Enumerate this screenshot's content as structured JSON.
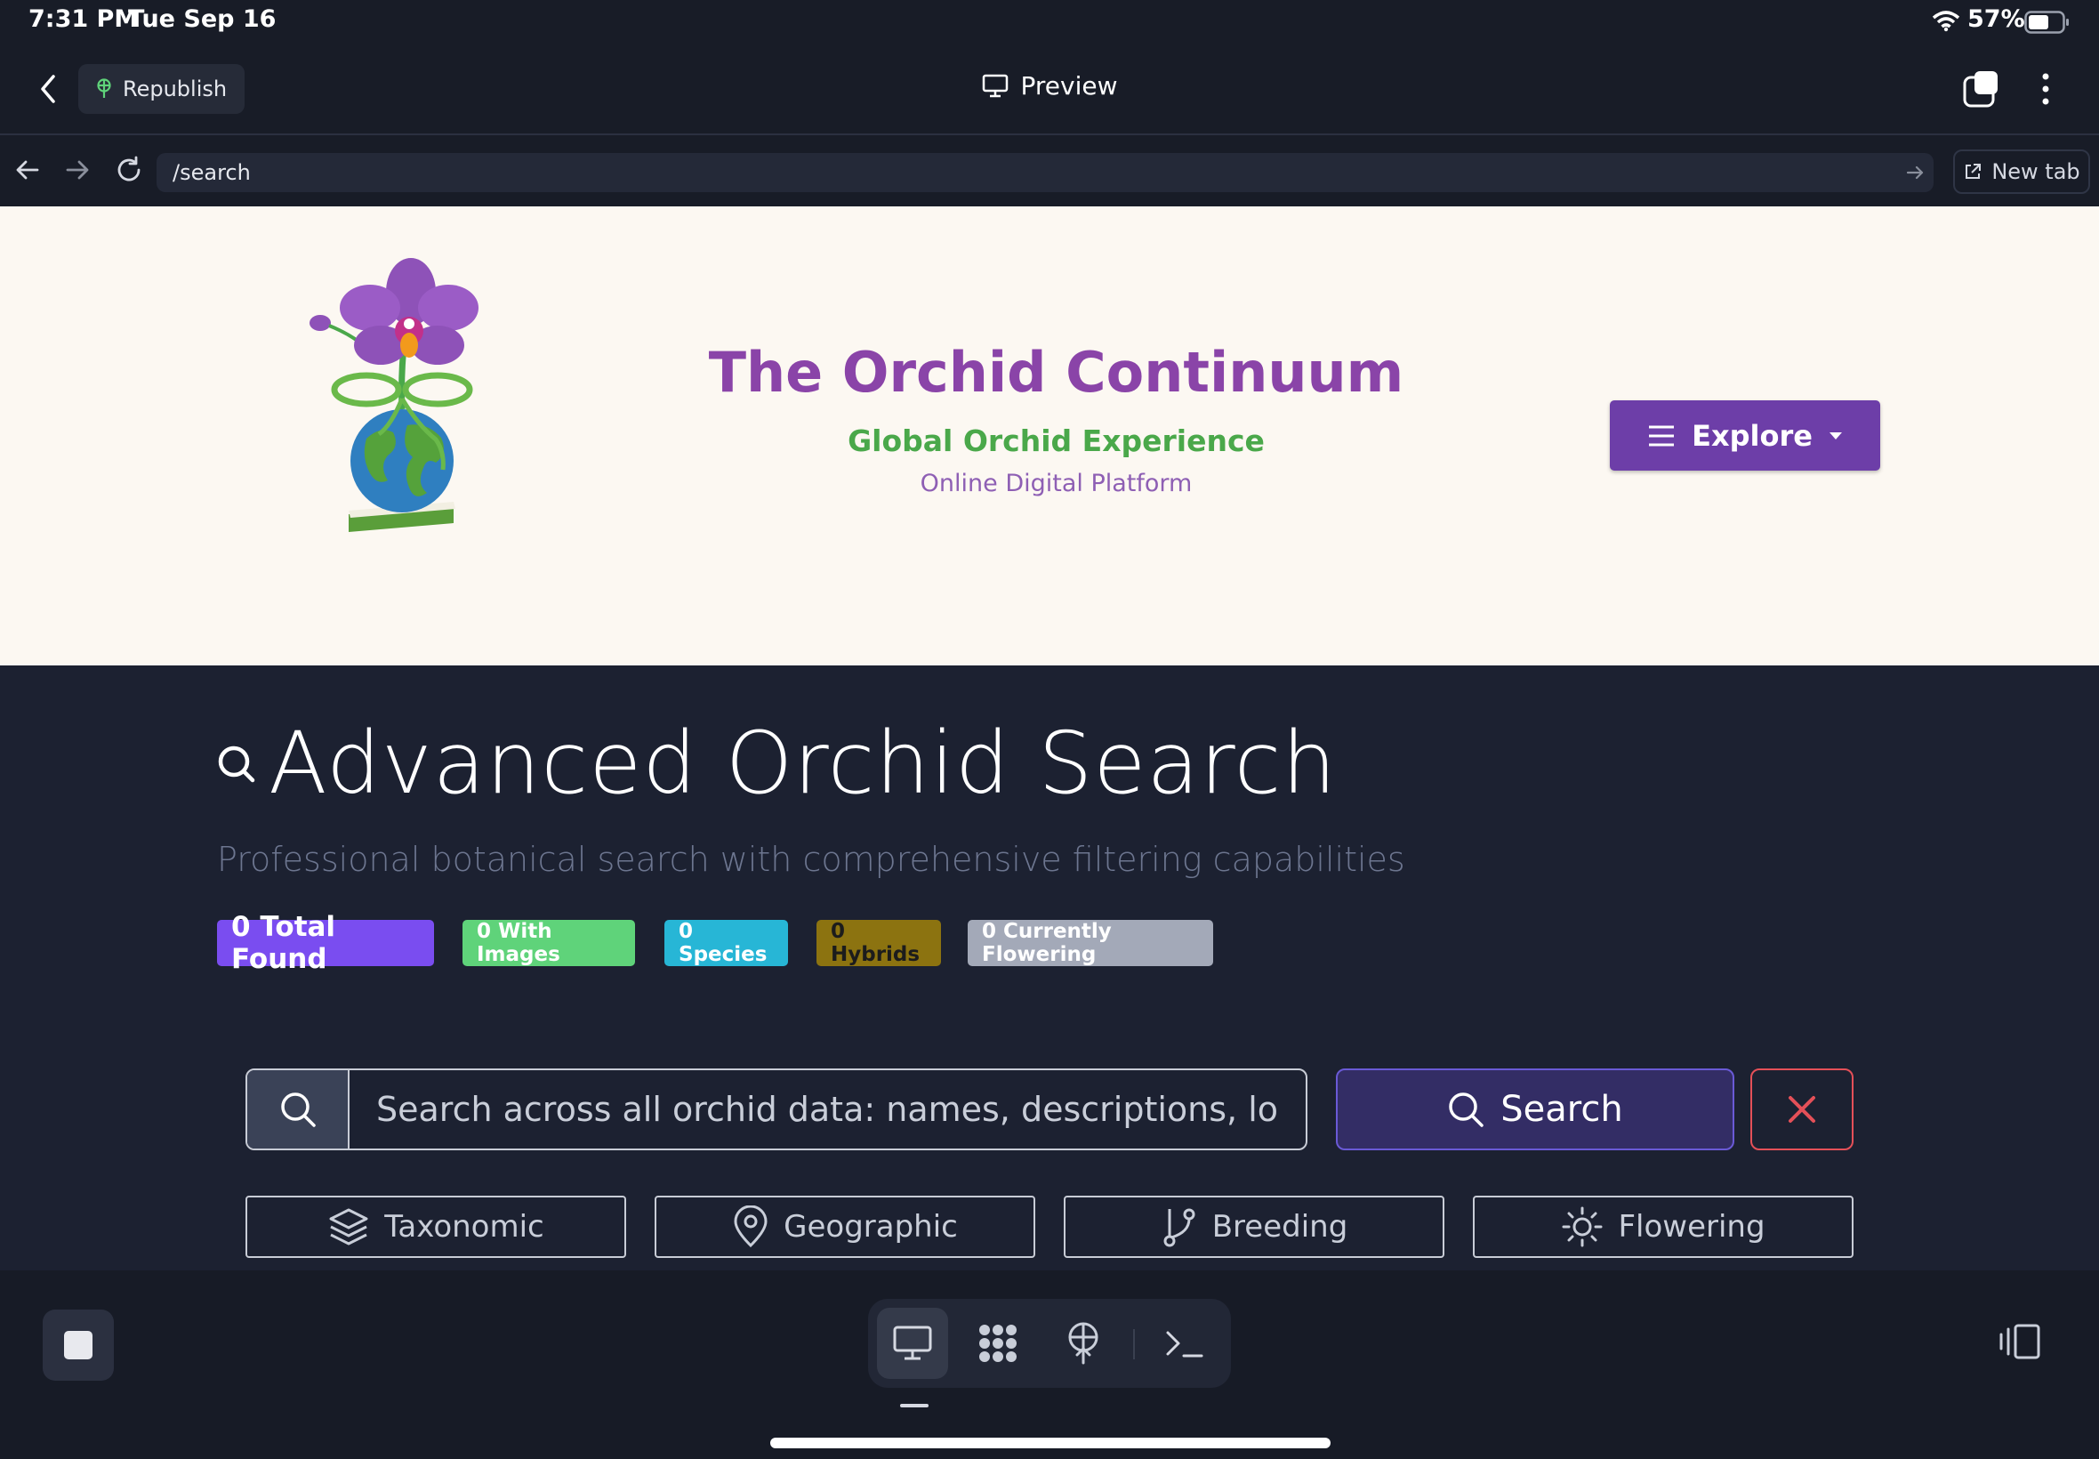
{
  "status_bar": {
    "time": "7:31 PM",
    "date": "Tue Sep 16",
    "battery": "57%"
  },
  "app_toolbar": {
    "republish_label": "Republish",
    "title": "Preview"
  },
  "url_bar": {
    "url": "/search",
    "new_tab_label": "New tab"
  },
  "site_header": {
    "title": "The Orchid Continuum",
    "tagline": "Global Orchid Experience",
    "subtitle": "Online Digital Platform",
    "explore_label": "Explore"
  },
  "search_page": {
    "title": "Advanced Orchid Search",
    "subtitle": "Professional botanical search with comprehensive filtering capabilities",
    "badges": [
      {
        "label": "0 Total Found",
        "color": "#7a4df0"
      },
      {
        "label": "0 With Images",
        "color": "#5fd37a"
      },
      {
        "label": "0 Species",
        "color": "#27b6d6"
      },
      {
        "label": "0 Hybrids",
        "color": "#8c7310"
      },
      {
        "label": "0 Currently Flowering",
        "color": "#a3a9b8"
      }
    ],
    "search_placeholder": "Search across all orchid data: names, descriptions, locations",
    "search_button": "Search",
    "filter_tabs": [
      "Taxonomic",
      "Geographic",
      "Breeding",
      "Flowering"
    ]
  },
  "colors": {
    "accent_purple": "#6d3ea8",
    "title_purple": "#8a44a8",
    "tagline_green": "#4aa84a",
    "page_background": "#1c2131",
    "clear_red": "#e45058"
  },
  "icons": {
    "toolbar": [
      "back-chevron-icon",
      "sprout-icon",
      "monitor-icon",
      "windows-icon",
      "more-vertical-icon"
    ],
    "url_bar": [
      "arrow-left-icon",
      "arrow-right-icon",
      "reload-icon",
      "go-arrow-icon",
      "external-link-icon"
    ],
    "dock": [
      "stop-icon",
      "monitor-icon",
      "grid-icon",
      "deploy-icon",
      "terminal-icon",
      "side-panel-icon"
    ]
  }
}
